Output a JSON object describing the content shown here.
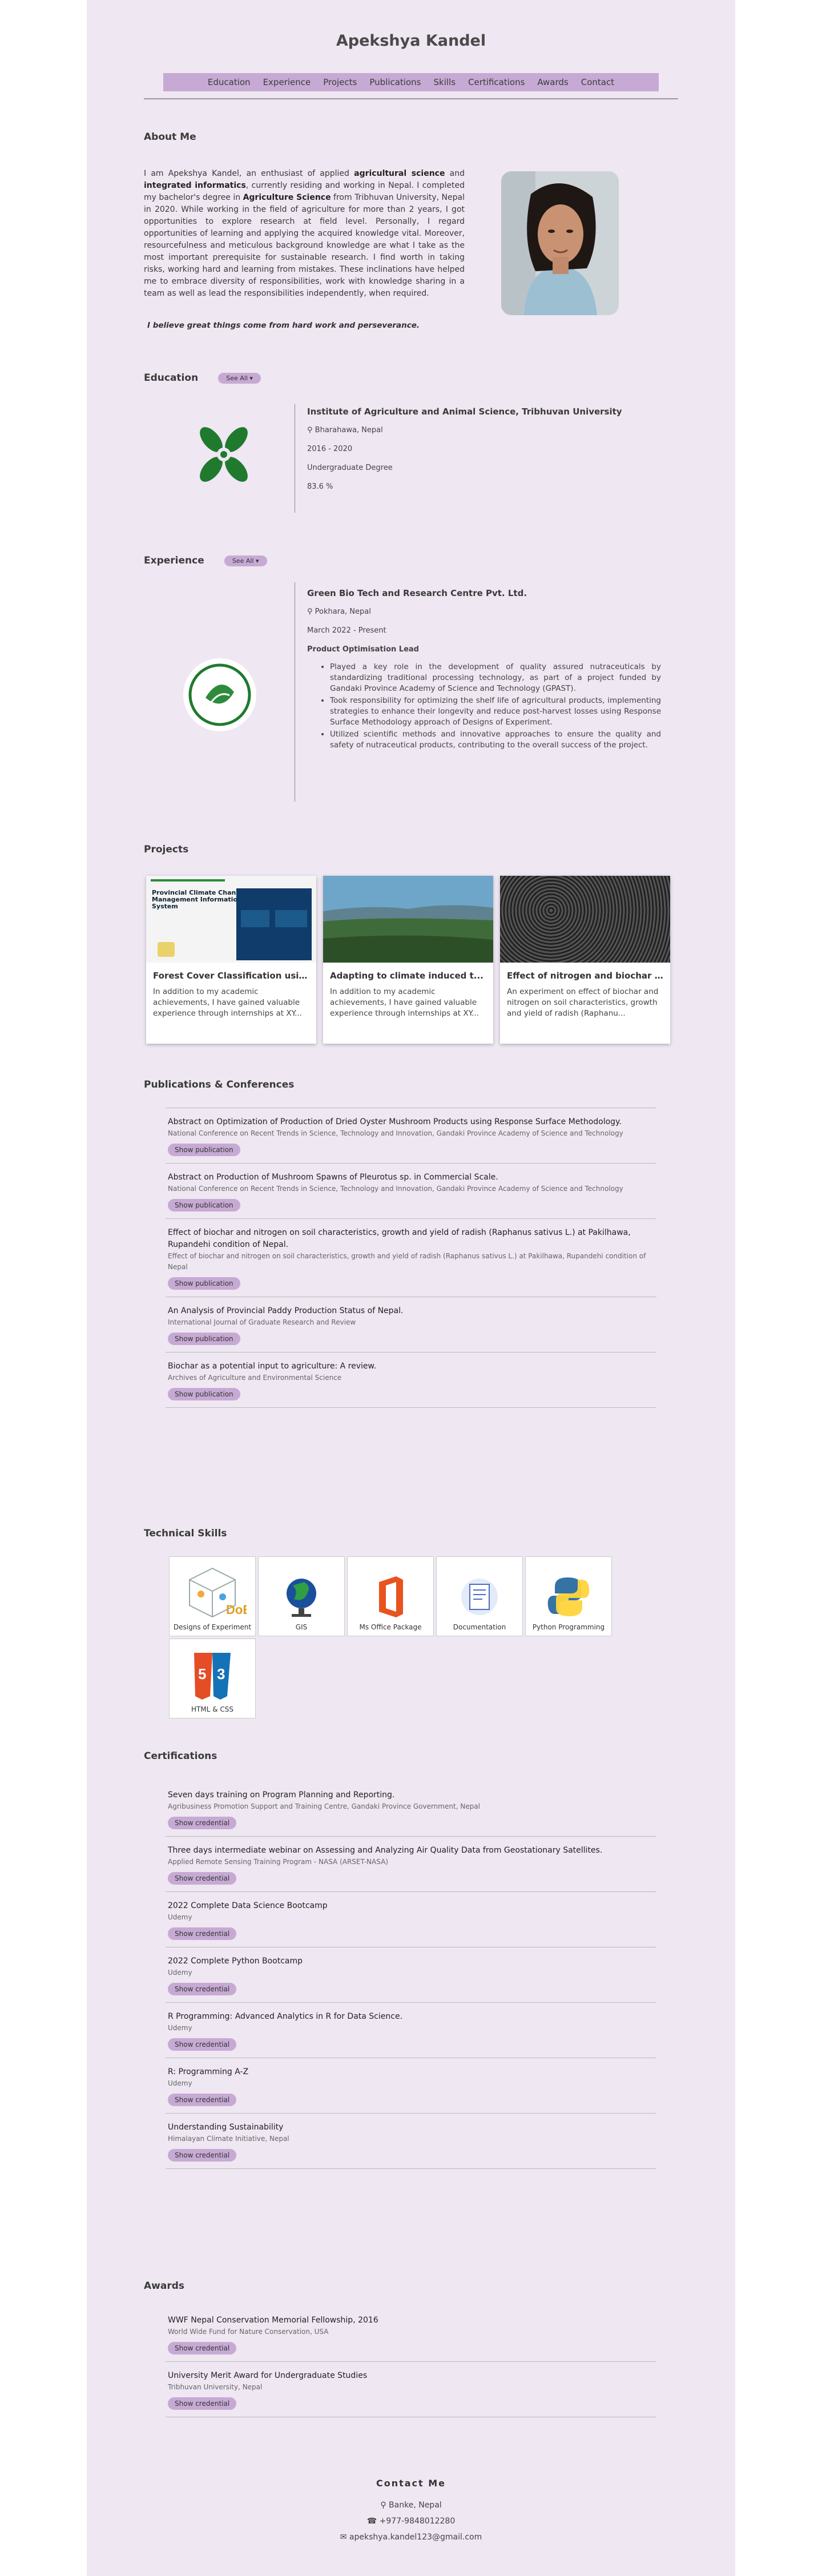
{
  "header": {
    "name": "Apekshya Kandel"
  },
  "nav": [
    "Education",
    "Experience",
    "Projects",
    "Publications",
    "Skills",
    "Certifications",
    "Awards",
    "Contact"
  ],
  "about": {
    "heading": "About Me",
    "p1": "I am Apekshya Kandel, an enthusiast of applied ",
    "b1": "agricultural science",
    "p2": " and ",
    "b2": "integrated informatics",
    "p3": ", currently residing and working in Nepal. I completed my bachelor's degree in ",
    "b3": "Agriculture Science",
    "p4": " from Tribhuvan University, Nepal in 2020. While working in the field of agriculture for more than 2 years, I got opportunities to explore research at field level. Personally, I regard opportunities of learning and applying the acquired knowledge vital. Moreover, resourcefulness and meticulous background knowledge are what I take as the most important prerequisite for sustainable research. I find worth in taking risks, working hard and learning from mistakes. These inclinations have helped me to embrace diversity of responsibilities, work with knowledge sharing in a team as well as lead the responsibilities independently, when required.",
    "quote": "I believe great things come from hard work and perseverance."
  },
  "education": {
    "heading": "Education",
    "see_all": "See All",
    "institution": "Institute of Agriculture and Animal Science, Tribhuvan University",
    "location": "Bharahawa, Nepal",
    "years": "2016 - 2020",
    "degree": "Undergraduate Degree",
    "score": "83.6 %"
  },
  "experience": {
    "heading": "Experience",
    "see_all": "See All",
    "company": "Green Bio Tech and Research Centre Pvt. Ltd.",
    "location": "Pokhara, Nepal",
    "dates": "March 2022 - Present",
    "role": "Product Optimisation Lead",
    "bullets": [
      "Played a key role in the development of quality assured nutraceuticals by standardizing traditional processing technology, as part of a project funded by Gandaki Province Academy of Science and Technology (GPAST).",
      "Took responsibility for optimizing the shelf life of agricultural products, implementing strategies to enhance their longevity and reduce post-harvest losses using Response Surface Methodology approach of Designs of Experiment.",
      "Utilized scientific methods and innovative approaches to ensure the quality and safety of nutraceutical products, contributing to the overall success of the project."
    ]
  },
  "projects": {
    "heading": "Projects",
    "items": [
      {
        "title": "Forest Cover Classification using...",
        "desc": "In addition to my academic achievements, I have gained valuable experience through internships at XY..."
      },
      {
        "title": "Adapting to climate induced t...",
        "desc": "In addition to my academic achievements, I have gained valuable experience through internships at XY..."
      },
      {
        "title": "Effect of nitrogen and biochar ...",
        "desc": "An experiment on effect of biochar and nitrogen on soil characteristics, growth and yield of radish (Raphanu..."
      }
    ],
    "screenshot": {
      "t1": "Provincial Climate Change",
      "t2": "Management Information",
      "t3": "System"
    }
  },
  "publications": {
    "heading": "Publications & Conferences",
    "button": "Show publication",
    "items": [
      {
        "title": "Abstract on Optimization of Production of Dried Oyster Mushroom Products using Response Surface Methodology.",
        "sub": "National Conference on Recent Trends in Science, Technology and Innovation, Gandaki Province Academy of Science and Technology"
      },
      {
        "title": "Abstract on Production of Mushroom Spawns of Pleurotus sp. in Commercial Scale.",
        "sub": "National Conference on Recent Trends in Science, Technology and Innovation, Gandaki Province Academy of Science and Technology"
      },
      {
        "title": "Effect of biochar and nitrogen on soil characteristics, growth and yield of radish (Raphanus sativus L.) at Pakilhawa, Rupandehi condition of Nepal.",
        "sub": "Effect of biochar and nitrogen on soil characteristics, growth and yield of radish (Raphanus sativus L.) at Pakilhawa, Rupandehi condition of Nepal"
      },
      {
        "title": "An Analysis of Provincial Paddy Production Status of Nepal.",
        "sub": "International Journal of Graduate Research and Review"
      },
      {
        "title": "Biochar as a potential input to agriculture: A review.",
        "sub": "Archives of Agriculture and Environmental Science"
      }
    ]
  },
  "skills": {
    "heading": "Technical Skills",
    "items": [
      "Designs of Experiment",
      "GIS",
      "Ms Office Package",
      "Documentation",
      "Python Programming",
      "HTML & CSS"
    ],
    "doe_badge": "DoE"
  },
  "certifications": {
    "heading": "Certifications",
    "button": "Show credential",
    "items": [
      {
        "title": "Seven days training on Program Planning and Reporting.",
        "sub": "Agribusiness Promotion Support and Training Centre, Gandaki Province Government, Nepal"
      },
      {
        "title": "Three days intermediate webinar on Assessing and Analyzing Air Quality Data from Geostationary Satellites.",
        "sub": "Applied Remote Sensing Training Program - NASA (ARSET-NASA)"
      },
      {
        "title": "2022 Complete Data Science Bootcamp",
        "sub": "Udemy"
      },
      {
        "title": "2022 Complete Python Bootcamp",
        "sub": "Udemy"
      },
      {
        "title": "R Programming: Advanced Analytics in R for Data Science.",
        "sub": "Udemy"
      },
      {
        "title": "R: Programming A-Z",
        "sub": "Udemy"
      },
      {
        "title": "Understanding Sustainability",
        "sub": "Himalayan Climate Initiative, Nepal"
      }
    ]
  },
  "awards": {
    "heading": "Awards",
    "button": "Show credential",
    "items": [
      {
        "title": "WWF Nepal Conservation Memorial Fellowship, 2016",
        "sub": "World Wide Fund for Nature Conservation, USA"
      },
      {
        "title": "University Merit Award for Undergraduate Studies",
        "sub": "Tribhuvan University, Nepal"
      }
    ]
  },
  "contact": {
    "heading": "Contact Me",
    "location": "Banke, Nepal",
    "phone": "+977-9848012280",
    "email": "apekshya.kandel123@gmail.com"
  },
  "colors": {
    "accent": "#c6aad4",
    "page_bg": "#efe7f2"
  }
}
